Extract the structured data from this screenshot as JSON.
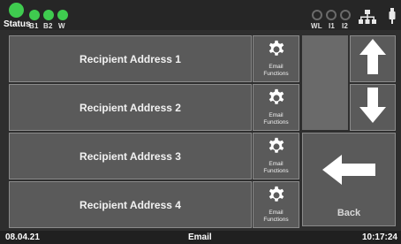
{
  "header": {
    "status_label": "Status",
    "indicators_left": [
      {
        "label": "B1",
        "color": "#3fcb4f"
      },
      {
        "label": "B2",
        "color": "#3fcb4f"
      },
      {
        "label": "W",
        "color": "#3fcb4f"
      }
    ],
    "indicators_right": [
      {
        "label": "WL"
      },
      {
        "label": "I1"
      },
      {
        "label": "I2"
      }
    ],
    "network_icon": "network-icon",
    "usb_icon": "usb-icon"
  },
  "recipients": [
    {
      "label": "Recipient Address 1",
      "action_label": "Email Functions"
    },
    {
      "label": "Recipient Address 2",
      "action_label": "Email Functions"
    },
    {
      "label": "Recipient Address 3",
      "action_label": "Email Functions"
    },
    {
      "label": "Recipient Address 4",
      "action_label": "Email Functions"
    }
  ],
  "navigation": {
    "up_icon": "arrow-up-icon",
    "down_icon": "arrow-down-icon",
    "back_label": "Back",
    "back_icon": "arrow-left-icon"
  },
  "footer": {
    "date": "08.04.21",
    "title": "Email",
    "time": "10:17:24"
  },
  "colors": {
    "status_green": "#3fcb4f",
    "button_bg": "#5a5a5a",
    "background": "#2e2e2e"
  }
}
